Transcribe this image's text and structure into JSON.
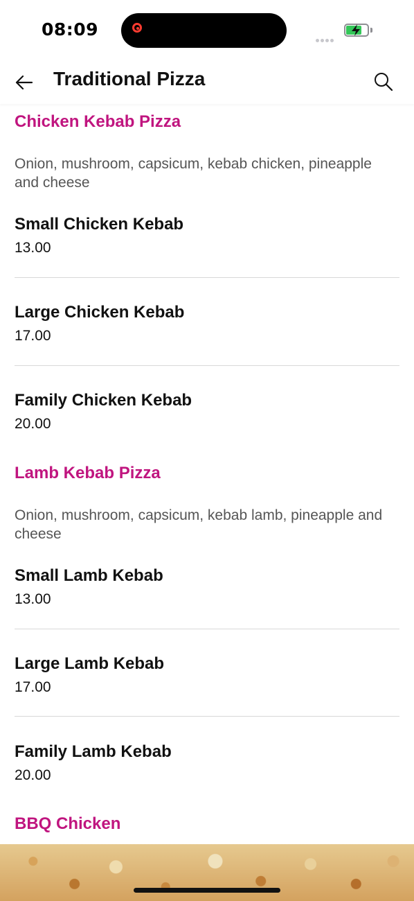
{
  "status_bar": {
    "time": "08:09"
  },
  "header": {
    "title": "Traditional Pizza",
    "back_icon": "arrow-left-icon",
    "search_icon": "search-icon"
  },
  "colors": {
    "accent": "#c0157f",
    "battery": "#34c759"
  },
  "sections": [
    {
      "title": "Chicken Kebab Pizza",
      "description": "Onion, mushroom, capsicum, kebab chicken, pineapple and cheese",
      "items": [
        {
          "name": "Small Chicken Kebab",
          "price": "13.00"
        },
        {
          "name": "Large Chicken Kebab",
          "price": "17.00"
        },
        {
          "name": "Family Chicken Kebab",
          "price": "20.00"
        }
      ]
    },
    {
      "title": "Lamb Kebab Pizza",
      "description": "Onion, mushroom, capsicum, kebab lamb, pineapple and cheese",
      "items": [
        {
          "name": "Small Lamb Kebab",
          "price": "13.00"
        },
        {
          "name": "Large Lamb Kebab",
          "price": "17.00"
        },
        {
          "name": "Family Lamb Kebab",
          "price": "20.00"
        }
      ]
    },
    {
      "title": "BBQ Chicken"
    }
  ]
}
